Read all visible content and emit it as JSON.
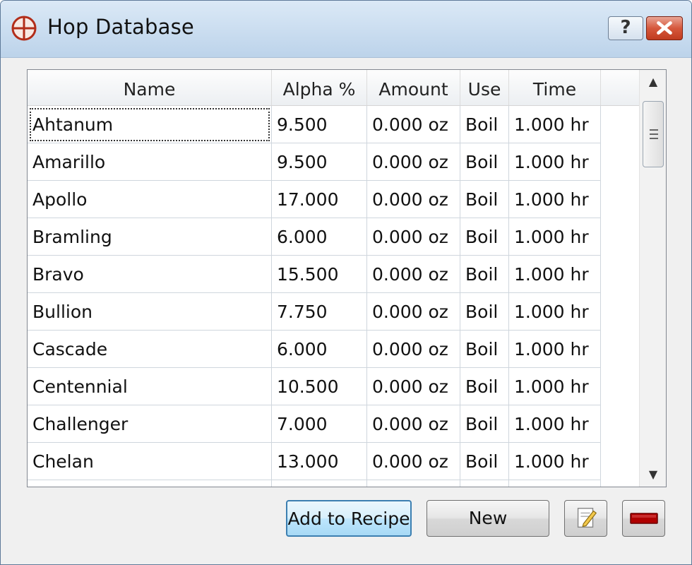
{
  "window": {
    "title": "Hop Database",
    "help_label": "?"
  },
  "table": {
    "columns": [
      "Name",
      "Alpha %",
      "Amount",
      "Use",
      "Time"
    ],
    "rows": [
      [
        "Ahtanum",
        "9.500",
        "0.000 oz",
        "Boil",
        "1.000 hr"
      ],
      [
        "Amarillo",
        "9.500",
        "0.000 oz",
        "Boil",
        "1.000 hr"
      ],
      [
        "Apollo",
        "17.000",
        "0.000 oz",
        "Boil",
        "1.000 hr"
      ],
      [
        "Bramling",
        "6.000",
        "0.000 oz",
        "Boil",
        "1.000 hr"
      ],
      [
        "Bravo",
        "15.500",
        "0.000 oz",
        "Boil",
        "1.000 hr"
      ],
      [
        "Bullion",
        "7.750",
        "0.000 oz",
        "Boil",
        "1.000 hr"
      ],
      [
        "Cascade",
        "6.000",
        "0.000 oz",
        "Boil",
        "1.000 hr"
      ],
      [
        "Centennial",
        "10.500",
        "0.000 oz",
        "Boil",
        "1.000 hr"
      ],
      [
        "Challenger",
        "7.000",
        "0.000 oz",
        "Boil",
        "1.000 hr"
      ],
      [
        "Chelan",
        "13.000",
        "0.000 oz",
        "Boil",
        "1.000 hr"
      ]
    ],
    "focused_row": 0
  },
  "buttons": {
    "add_to_recipe": "Add to Recipe",
    "new": "New",
    "edit_icon": "edit-icon",
    "remove_icon": "remove-icon"
  },
  "colors": {
    "title_gradient_top": "#dbe9f6",
    "close_red": "#c03b1f",
    "remove_red": "#b00000",
    "default_button_border": "#3c7fb1"
  }
}
